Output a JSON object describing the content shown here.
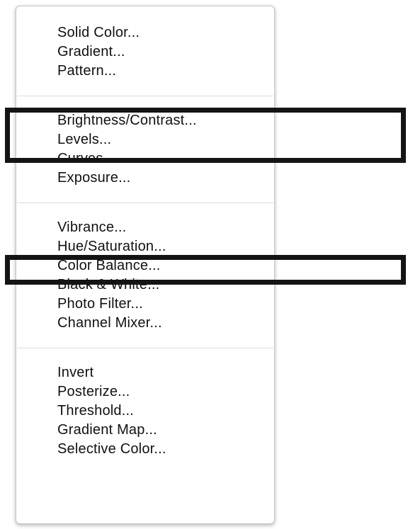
{
  "menu": {
    "groups": [
      {
        "items": [
          "Solid Color...",
          "Gradient...",
          "Pattern..."
        ]
      },
      {
        "items": [
          "Brightness/Contrast...",
          "Levels...",
          "Curves...",
          "Exposure..."
        ]
      },
      {
        "items": [
          "Vibrance...",
          "Hue/Saturation...",
          "Color Balance...",
          "Black & White...",
          "Photo Filter...",
          "Channel Mixer..."
        ]
      },
      {
        "items": [
          "Invert",
          "Posterize...",
          "Threshold...",
          "Gradient Map...",
          "Selective Color..."
        ]
      }
    ]
  },
  "annotations": {
    "highlighted_items": [
      "Brightness/Contrast...",
      "Levels...",
      "Hue/Saturation..."
    ],
    "highlight_color": "#141414"
  }
}
